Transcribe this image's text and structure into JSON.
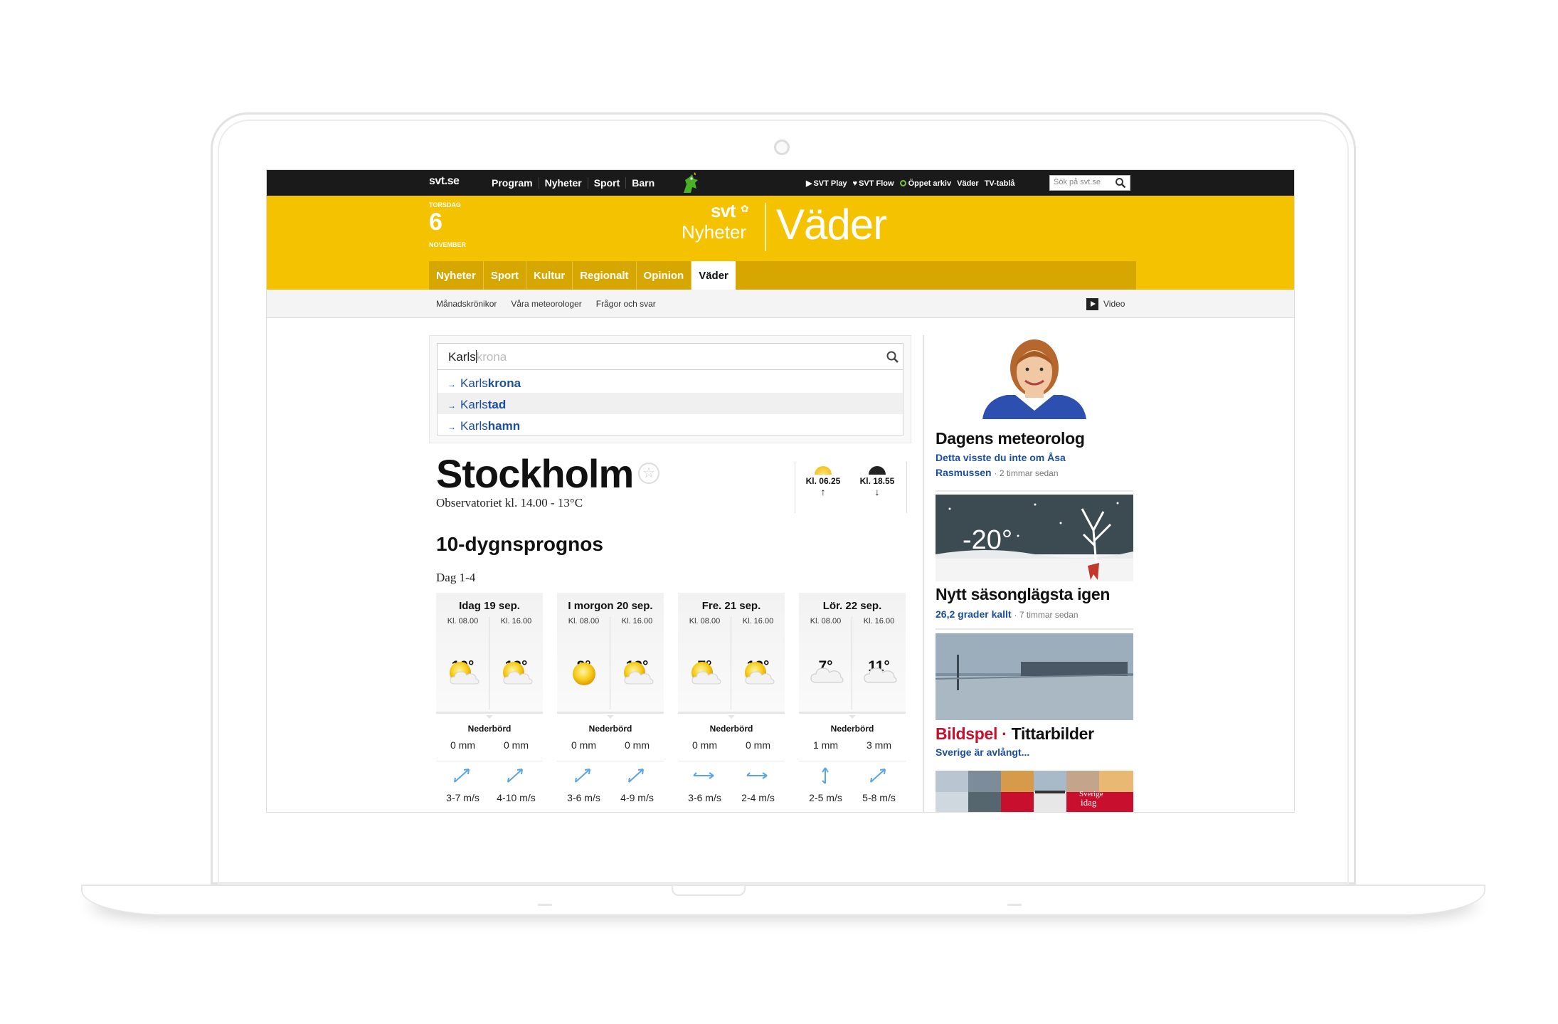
{
  "topbar": {
    "logo": "svt.se",
    "nav": [
      "Program",
      "Nyheter",
      "Sport",
      "Barn"
    ],
    "links": {
      "play": "SVT Play",
      "flow": "SVT Flow",
      "arkiv": "Öppet arkiv",
      "vader": "Väder",
      "tabla": "TV-tablå"
    },
    "search_placeholder": "Sök på svt.se"
  },
  "header": {
    "weekday": "TORSDAG",
    "day": "6",
    "month": "NOVEMBER",
    "brand_svt": "svt",
    "brand_nyheter": "Nyheter",
    "section": "Väder",
    "nav": [
      "Nyheter",
      "Sport",
      "Kultur",
      "Regionalt",
      "Opinion",
      "Väder"
    ],
    "active": "Väder"
  },
  "subnav": {
    "items": [
      "Månadskrönikor",
      "Våra meteorologer",
      "Frågor och svar"
    ],
    "video": "Video"
  },
  "search": {
    "typed": "Karls",
    "completion": "krona",
    "suggestions": [
      {
        "prefix": "Karls",
        "rest": "krona"
      },
      {
        "prefix": "Karls",
        "rest": "tad"
      },
      {
        "prefix": "Karls",
        "rest": "hamn"
      }
    ]
  },
  "city": {
    "name": "Stockholm",
    "observation": "Observatoriet kl. 14.00 - 13°C",
    "sunrise": "Kl. 06.25",
    "sunset": "Kl. 18.55"
  },
  "forecast": {
    "heading": "10-dygnsprognos",
    "range": "Dag 1-4",
    "precip_label": "Nederbörd",
    "days": [
      {
        "title": "Idag 19 sep.",
        "slots": [
          {
            "time": "Kl. 08.00",
            "icon": "sun-cloud-icon",
            "temp": "10°",
            "precip": "0 mm",
            "wind": "3-7 m/s",
            "wind_dir": "northeast"
          },
          {
            "time": "Kl. 16.00",
            "icon": "sun-cloud-icon",
            "temp": "13°",
            "precip": "0 mm",
            "wind": "4-10 m/s",
            "wind_dir": "northeast"
          }
        ]
      },
      {
        "title": "I morgon 20 sep.",
        "slots": [
          {
            "time": "Kl. 08.00",
            "icon": "sun-icon",
            "temp": "8°",
            "precip": "0 mm",
            "wind": "3-6 m/s",
            "wind_dir": "northeast"
          },
          {
            "time": "Kl. 16.00",
            "icon": "sun-cloud-icon",
            "temp": "13°",
            "precip": "0 mm",
            "wind": "4-9 m/s",
            "wind_dir": "northeast"
          }
        ]
      },
      {
        "title": "Fre. 21 sep.",
        "slots": [
          {
            "time": "Kl. 08.00",
            "icon": "sun-cloud-icon",
            "temp": "7°",
            "precip": "0 mm",
            "wind": "3-6 m/s",
            "wind_dir": "east"
          },
          {
            "time": "Kl. 16.00",
            "icon": "sun-cloud-icon",
            "temp": "12°",
            "precip": "0 mm",
            "wind": "2-4 m/s",
            "wind_dir": "east"
          }
        ]
      },
      {
        "title": "Lör. 22 sep.",
        "slots": [
          {
            "time": "Kl. 08.00",
            "icon": "cloud-icon",
            "temp": "7°",
            "precip": "1 mm",
            "wind": "2-5 m/s",
            "wind_dir": "north"
          },
          {
            "time": "Kl. 16.00",
            "icon": "cloud-icon",
            "temp": "11°",
            "precip": "3 mm",
            "wind": "5-8 m/s",
            "wind_dir": "northeast"
          }
        ]
      }
    ]
  },
  "sidebar": {
    "meteorolog": {
      "title": "Dagens meteorolog",
      "link": "Detta visste du inte om Åsa Rasmussen",
      "time": "· 2 timmar sedan"
    },
    "cold": {
      "image_temp": "-20°",
      "title": "Nytt säsonglägsta igen",
      "link": "26,2 grader kallt",
      "time": "· 7 timmar sedan"
    },
    "bildspel": {
      "label": "Bildspel",
      "dot": "·",
      "title": "Tittarbilder",
      "link": "Sverige är avlångt..."
    },
    "thumb_text": [
      "Sverige",
      "idag"
    ]
  },
  "colors": {
    "brand_yellow": "#f5c200",
    "nav_yellow": "#d6a700",
    "link_blue": "#1c4ea0",
    "bildspel_red": "#c8102e"
  }
}
